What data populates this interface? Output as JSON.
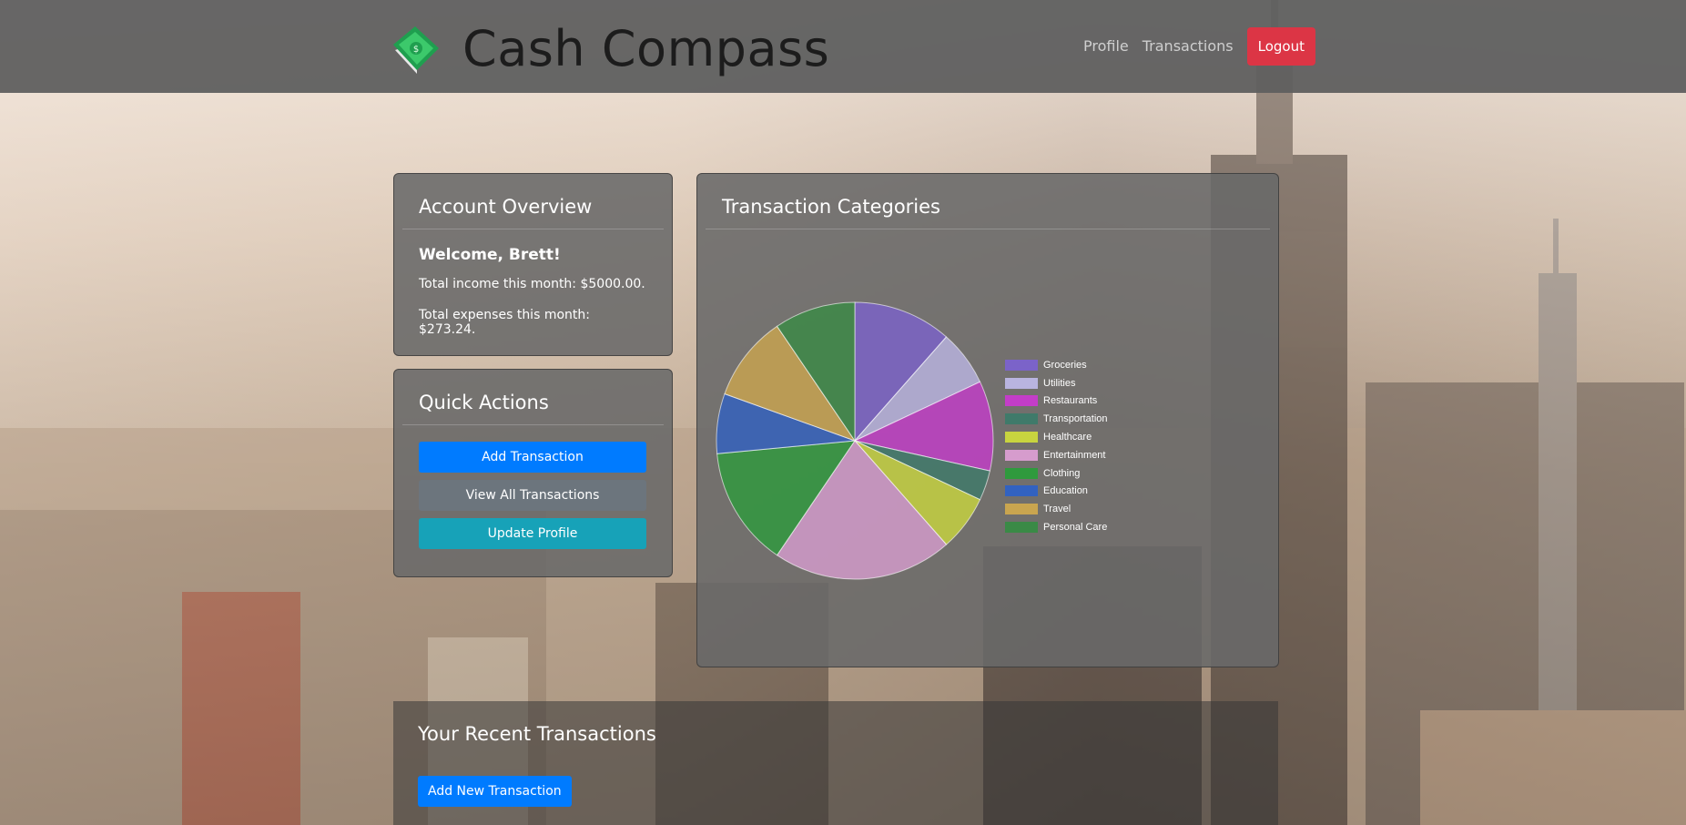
{
  "brand": {
    "title": "Cash Compass",
    "logo_icon": "money-bill-logo-icon"
  },
  "nav": {
    "profile": "Profile",
    "transactions": "Transactions",
    "logout": "Logout"
  },
  "account_overview": {
    "title": "Account Overview",
    "welcome": "Welcome, Brett!",
    "income": "Total income this month: $5000.00.",
    "expenses": "Total expenses this month: $273.24."
  },
  "quick_actions": {
    "title": "Quick Actions",
    "add_transaction": "Add Transaction",
    "view_all": "View All Transactions",
    "update_profile": "Update Profile"
  },
  "categories_card": {
    "title": "Transaction Categories"
  },
  "recent": {
    "title": "Your Recent Transactions",
    "add_new": "Add New Transaction"
  },
  "colors": {
    "primary": "#007bff",
    "secondary": "#6c757d",
    "info": "#17a2b8",
    "danger": "#dc3545"
  },
  "chart_data": {
    "type": "pie",
    "legend_placement": "right",
    "slices": [
      {
        "label": "Groceries",
        "value": 11.5,
        "color": "#7b63c9"
      },
      {
        "label": "Utilities",
        "value": 6.5,
        "color": "#b9b4e0"
      },
      {
        "label": "Restaurants",
        "value": 10.5,
        "color": "#c33dc8"
      },
      {
        "label": "Transportation",
        "value": 3.5,
        "color": "#3f7a6a"
      },
      {
        "label": "Healthcare",
        "value": 6.5,
        "color": "#c8d43f"
      },
      {
        "label": "Entertainment",
        "value": 21.0,
        "color": "#d69ccd"
      },
      {
        "label": "Clothing",
        "value": 14.0,
        "color": "#2f9a3d"
      },
      {
        "label": "Education",
        "value": 7.0,
        "color": "#3262c0"
      },
      {
        "label": "Travel",
        "value": 10.0,
        "color": "#c9a54f"
      },
      {
        "label": "Personal Care",
        "value": 9.5,
        "color": "#3a8a46"
      }
    ]
  }
}
